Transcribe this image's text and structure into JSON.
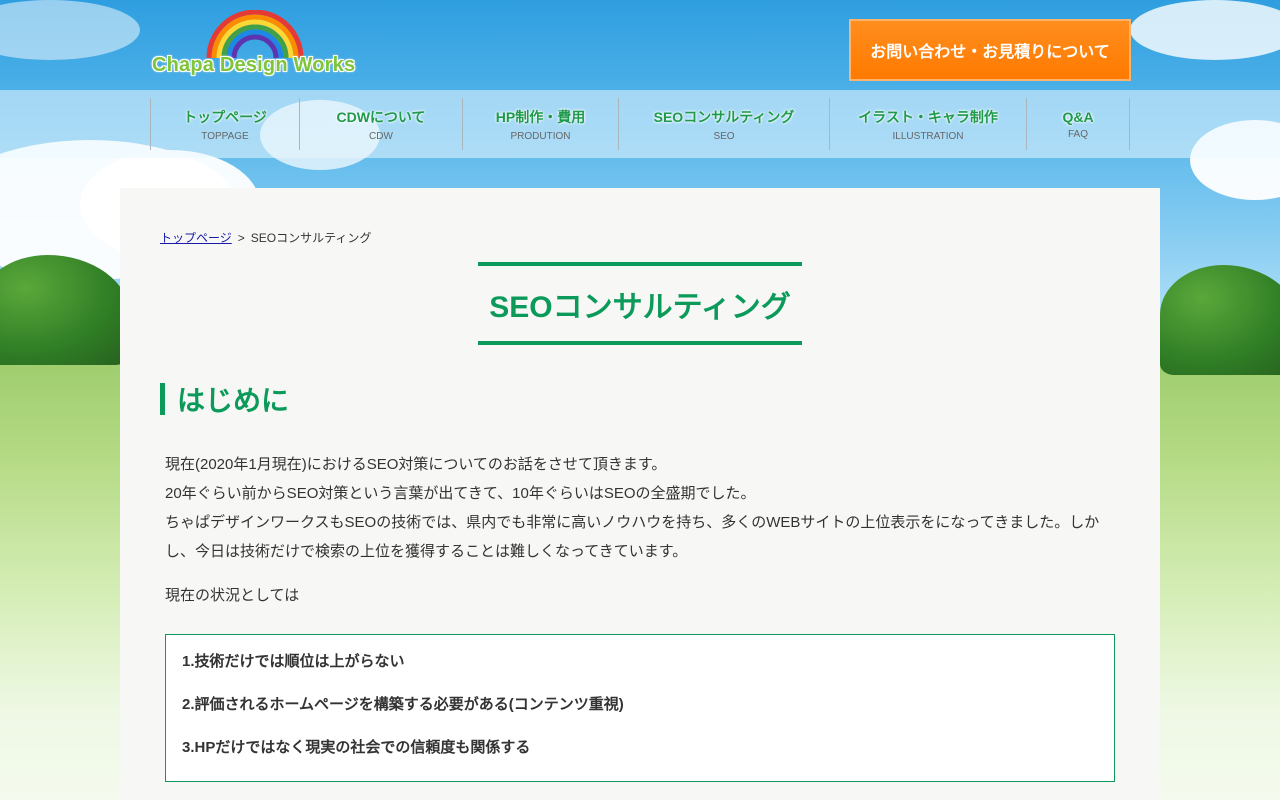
{
  "header": {
    "logo_text": "Chapa Design Works",
    "contact_button": "お問い合わせ・お見積りについて"
  },
  "nav": {
    "items": [
      {
        "label": "トップページ",
        "sub": "TOPPAGE"
      },
      {
        "label": "CDWについて",
        "sub": "CDW"
      },
      {
        "label": "HP制作・費用",
        "sub": "PRODUTION"
      },
      {
        "label": "SEOコンサルティング",
        "sub": "SEO"
      },
      {
        "label": "イラスト・キャラ制作",
        "sub": "ILLUSTRATION"
      },
      {
        "label": "Q&A",
        "sub": "FAQ"
      }
    ]
  },
  "breadcrumb": {
    "home": "トップページ",
    "separator": ">",
    "current": "SEOコンサルティング"
  },
  "main": {
    "title": "SEOコンサルティング",
    "section_heading": "はじめに",
    "intro_lines": [
      "現在(2020年1月現在)におけるSEO対策についてのお話をさせて頂きます。",
      "20年ぐらい前からSEO対策という言葉が出てきて、10年ぐらいはSEOの全盛期でした。",
      "ちゃぱデザインワークスもSEOの技術では、県内でも非常に高いノウハウを持ち、多くのWEBサイトの上位表示をになってきました。しかし、今日は技術だけで検索の上位を獲得することは難しくなってきています。"
    ],
    "status_lead": "現在の状況としては",
    "points": [
      "1.技術だけでは順位は上がらない",
      "2.評価されるホームページを構築する必要がある(コンテンツ重視)",
      "3.HPだけではなく現実の社会での信頼度も関係する"
    ]
  },
  "colors": {
    "accent_green": "#0b9a5a",
    "nav_green": "#1f9a4c",
    "contact_orange": "#ff7a00",
    "link_blue": "#1a1aa8"
  },
  "icons": {
    "logo": "rainbow-icon"
  }
}
